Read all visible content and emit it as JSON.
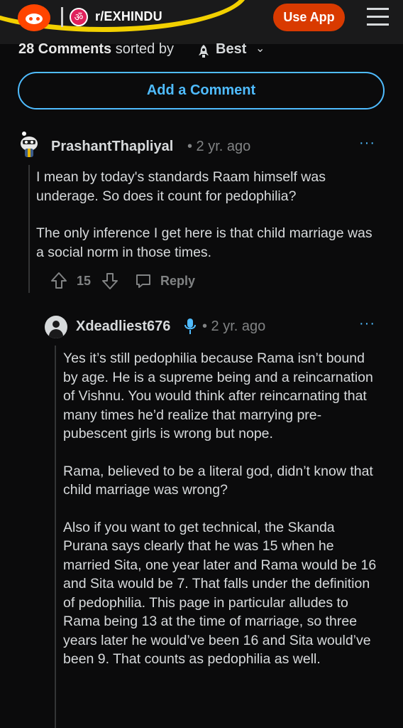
{
  "header": {
    "subreddit": "r/EXHINDU",
    "subreddit_icon_glyph": "ॐ",
    "use_app_label": "Use App"
  },
  "sort": {
    "count_label": "28 Comments",
    "sorted_by_label": "sorted by",
    "sort_value": "Best",
    "chevron": "⌄"
  },
  "add_comment_label": "Add a Comment",
  "comments": [
    {
      "author": "PrashantThapliyal",
      "age": "• 2 yr. ago",
      "more": "···",
      "paragraphs": [
        "I mean by today's standards Raam himself was underage. So does it count for pedophilia?",
        "The only inference I get here is that child marriage was a social norm in those times."
      ],
      "score": "15",
      "reply_label": "Reply"
    },
    {
      "author": "Xdeadliest676",
      "age": "• 2 yr. ago",
      "more": "···",
      "paragraphs": [
        "Yes it’s still pedophilia because Rama isn’t bound by age. He is a supreme being and a reincarnation of Vishnu. You would think after reincarnating that many times he’d realize that marrying pre-pubescent girls is wrong but nope.",
        "Rama, believed to be a literal god, didn’t know that child marriage was wrong?",
        "Also if you want to get technical, the Skanda Purana says clearly that he was 15 when he married Sita, one year later and Rama would be 16 and Sita would be 7. That falls under the definition of pedophilia. This page in particular alludes to Rama being 13 at the time of marriage, so three years later he would’ve been 16 and Sita would’ve been 9. That counts as pedophilia as well."
      ]
    }
  ],
  "colors": {
    "background": "#0b0b0c",
    "header_bg": "#1a1a1b",
    "accent_blue": "#4fbcff",
    "use_app_orange": "#d93a00",
    "reddit_orange": "#ff4500",
    "muted_text": "#818384",
    "highlight_yellow": "#f2d000"
  },
  "icons": [
    "reddit-logo-icon",
    "subreddit-icon",
    "hamburger-menu-icon",
    "sort-rocket-icon",
    "upvote-icon",
    "downvote-icon",
    "reply-icon",
    "avatar-icon",
    "microphone-icon",
    "more-options-icon"
  ]
}
